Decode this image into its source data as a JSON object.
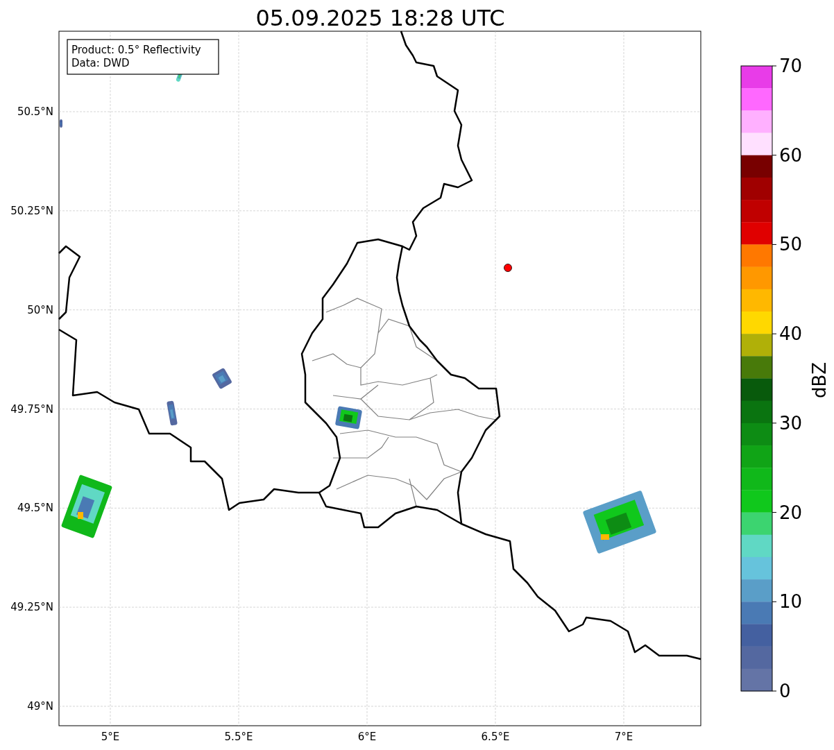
{
  "title": "05.09.2025 18:28 UTC",
  "info_box": [
    "Product: 0.5° Reflectivity",
    "Data: DWD"
  ],
  "x_axis": {
    "ticks": [
      "5°E",
      "5.5°E",
      "6°E",
      "6.5°E",
      "7°E"
    ]
  },
  "y_axis": {
    "ticks": [
      "50.5°N",
      "50.25°N",
      "50°N",
      "49.75°N",
      "49.5°N",
      "49.25°N",
      "49°N"
    ]
  },
  "colorbar": {
    "label": "dBZ",
    "ticks": [
      "70",
      "60",
      "50",
      "40",
      "30",
      "20",
      "10",
      "0"
    ],
    "bins": [
      {
        "color": "#e83ce8"
      },
      {
        "color": "#ff68ff"
      },
      {
        "color": "#ffb0ff"
      },
      {
        "color": "#ffe0ff"
      },
      {
        "color": "#780000"
      },
      {
        "color": "#a00000"
      },
      {
        "color": "#c00000"
      },
      {
        "color": "#e00000"
      },
      {
        "color": "#ff7800"
      },
      {
        "color": "#ff9800"
      },
      {
        "color": "#ffb800"
      },
      {
        "color": "#ffd800"
      },
      {
        "color": "#b0b008"
      },
      {
        "color": "#487a0a"
      },
      {
        "color": "#085a0c"
      },
      {
        "color": "#0a7410"
      },
      {
        "color": "#0d8c14"
      },
      {
        "color": "#10a416"
      },
      {
        "color": "#10b81a"
      },
      {
        "color": "#10c81c"
      },
      {
        "color": "#3cd470"
      },
      {
        "color": "#60d8c4"
      },
      {
        "color": "#66c3dc"
      },
      {
        "color": "#5a9ec8"
      },
      {
        "color": "#4a7ab4"
      },
      {
        "color": "#4460a0"
      },
      {
        "color": "#5468a0"
      },
      {
        "color": "#6474a6"
      }
    ]
  }
}
